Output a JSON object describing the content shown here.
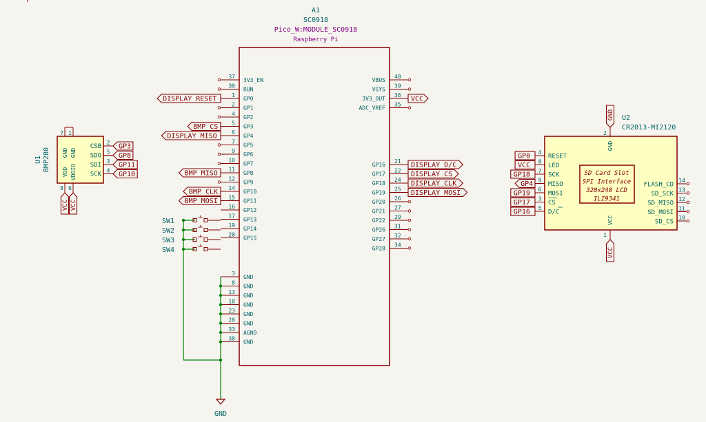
{
  "colors": {
    "background": "#f5f4ef",
    "body_stroke": "#840000",
    "body_fill": "#ffffc2",
    "wire": "#008400",
    "pin_text": "#006464",
    "ref_text": "#006464",
    "value_text": "#840084",
    "net_label_stroke": "#840000",
    "net_label_text": "#840000"
  },
  "a1": {
    "ref": "A1",
    "value": "SC0918",
    "footprint": "Pico_W:MODULE_SC0918",
    "desc": "Raspberry Pi",
    "left_pins": [
      {
        "num": "37",
        "name": "3V3_EN"
      },
      {
        "num": "30",
        "name": "RUN"
      },
      {
        "num": "1",
        "name": "GP0"
      },
      {
        "num": "2",
        "name": "GP1"
      },
      {
        "num": "4",
        "name": "GP2"
      },
      {
        "num": "5",
        "name": "GP3"
      },
      {
        "num": "6",
        "name": "GP4"
      },
      {
        "num": "7",
        "name": "GP5"
      },
      {
        "num": "9",
        "name": "GP6"
      },
      {
        "num": "10",
        "name": "GP7"
      },
      {
        "num": "11",
        "name": "GP8"
      },
      {
        "num": "12",
        "name": "GP9"
      },
      {
        "num": "14",
        "name": "GP10"
      },
      {
        "num": "15",
        "name": "GP11"
      },
      {
        "num": "16",
        "name": "GP12"
      },
      {
        "num": "17",
        "name": "GP13"
      },
      {
        "num": "19",
        "name": "GP14"
      },
      {
        "num": "20",
        "name": "GP15"
      },
      {
        "num": "3",
        "name": "GND"
      },
      {
        "num": "8",
        "name": "GND"
      },
      {
        "num": "13",
        "name": "GND"
      },
      {
        "num": "18",
        "name": "GND"
      },
      {
        "num": "23",
        "name": "GND"
      },
      {
        "num": "28",
        "name": "GND"
      },
      {
        "num": "33",
        "name": "AGND"
      },
      {
        "num": "38",
        "name": "GND"
      }
    ],
    "right_pins": [
      {
        "num": "40",
        "name": "VBUS"
      },
      {
        "num": "39",
        "name": "VSYS"
      },
      {
        "num": "36",
        "name": "3V3_OUT"
      },
      {
        "num": "35",
        "name": "ADC_VREF"
      },
      {
        "num": "21",
        "name": "GP16"
      },
      {
        "num": "22",
        "name": "GP17"
      },
      {
        "num": "24",
        "name": "GP18"
      },
      {
        "num": "25",
        "name": "GP19"
      },
      {
        "num": "26",
        "name": "GP20"
      },
      {
        "num": "27",
        "name": "GP21"
      },
      {
        "num": "29",
        "name": "GP22"
      },
      {
        "num": "31",
        "name": "GP26"
      },
      {
        "num": "32",
        "name": "GP27"
      },
      {
        "num": "34",
        "name": "GP28"
      }
    ],
    "left_labels": [
      {
        "pin": "GP0",
        "text": "DISPLAY_RESET"
      },
      {
        "pin": "GP3",
        "text": "BMP_CS"
      },
      {
        "pin": "GP4",
        "text": "DISPLAY_MISO"
      },
      {
        "pin": "GP8",
        "text": "BMP_MISO"
      },
      {
        "pin": "GP10",
        "text": "BMP_CLK"
      },
      {
        "pin": "GP11",
        "text": "BMP_MOSI"
      }
    ],
    "right_labels": [
      {
        "pin": "3V3_OUT",
        "text": "VCC"
      },
      {
        "pin": "GP16",
        "text": "DISPLAY_D/C"
      },
      {
        "pin": "GP17",
        "text": "DISPLAY_CS"
      },
      {
        "pin": "GP18",
        "text": "DISPLAY_CLK"
      },
      {
        "pin": "GP19",
        "text": "DISPLAY_MOSI"
      }
    ]
  },
  "switches": [
    "SW1",
    "SW2",
    "SW3",
    "SW4"
  ],
  "gnd_symbol": "GND",
  "u1": {
    "ref": "U1",
    "value": "BMP280",
    "pins": [
      {
        "num": "7",
        "name": "GND",
        "side": "top"
      },
      {
        "num": "1",
        "name": "GND",
        "side": "top"
      },
      {
        "num": "8",
        "name": "VDD",
        "side": "bottom"
      },
      {
        "num": "6",
        "name": "VDDIO",
        "side": "bottom"
      },
      {
        "num": "2",
        "name": "CSB",
        "side": "right",
        "label": "GP3"
      },
      {
        "num": "5",
        "name": "SDO",
        "side": "right",
        "label": "GP8"
      },
      {
        "num": "3",
        "name": "SDI",
        "side": "right",
        "label": "GP11"
      },
      {
        "num": "4",
        "name": "SCK",
        "side": "right",
        "label": "GP10"
      }
    ],
    "bottom_labels": [
      "VCC",
      "VCC"
    ]
  },
  "u2": {
    "ref": "U2",
    "value": "CR2013-MI2120",
    "top_pin": {
      "num": "2",
      "name": "GND",
      "label": "GND"
    },
    "bottom_pin": {
      "num": "1",
      "name": "VCC",
      "label": "VCC"
    },
    "left_pins": [
      {
        "num": "4",
        "name": "RESET",
        "label": "GP0"
      },
      {
        "num": "8",
        "name": "LED",
        "label": "VCC"
      },
      {
        "num": "7",
        "name": "SCK",
        "label": "GP18"
      },
      {
        "num": "9",
        "name": "MISO",
        "label": "GP4"
      },
      {
        "num": "6",
        "name": "MOSI",
        "label": "GP19"
      },
      {
        "num": "3",
        "name": "CS",
        "label": "GP17"
      },
      {
        "num": "5",
        "name": "D/C",
        "label": "GP16"
      }
    ],
    "right_pins": [
      {
        "num": "14",
        "name": "FLASH_CD"
      },
      {
        "num": "13",
        "name": "SD_SCK"
      },
      {
        "num": "12",
        "name": "SD_MISO"
      },
      {
        "num": "11",
        "name": "SD_MOSI"
      },
      {
        "num": "10",
        "name": "SD_CS"
      }
    ],
    "inner_box": [
      "SD Card Slot",
      "SPI Interface",
      "320x240 LCD",
      "ILI9341"
    ]
  }
}
